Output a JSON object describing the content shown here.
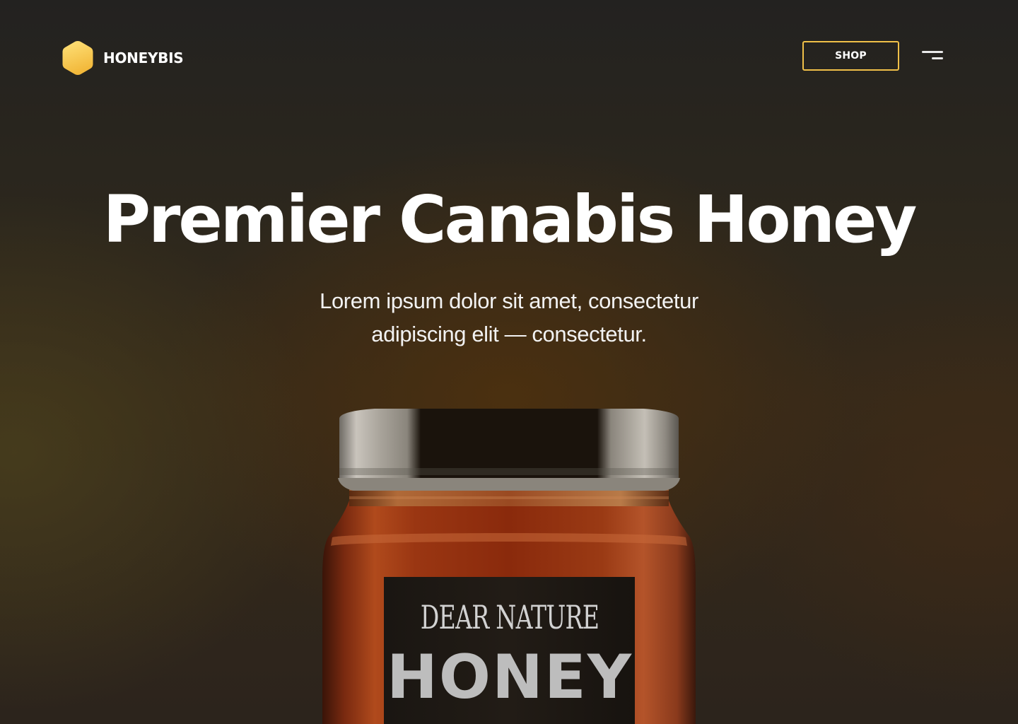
{
  "header": {
    "brand_name": "HONEYBIS",
    "shop_label": "SHOP",
    "logo_icon": "hexagon-logo-icon",
    "menu_icon": "hamburger-menu-icon"
  },
  "hero": {
    "title": "Premier Canabis Honey",
    "subtitle_line1": "Lorem ipsum dolor sit amet, consectetur",
    "subtitle_line2": "adipiscing elit — consectetur."
  },
  "product": {
    "label_brand": "DEAR NATURE",
    "label_name": "HONEY"
  },
  "colors": {
    "accent": "#f0c048",
    "text": "#ffffff",
    "background": "#2a251c"
  }
}
